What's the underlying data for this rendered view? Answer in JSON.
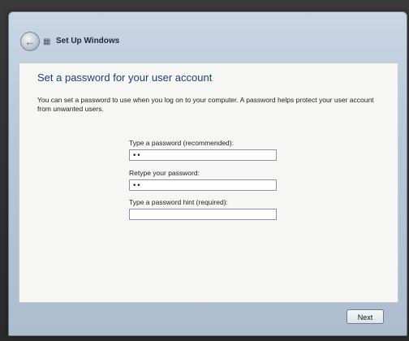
{
  "window": {
    "title": "Set Up Windows"
  },
  "page": {
    "heading": "Set a password for your user account",
    "description": "You can set a password to use when you log on to your computer. A password helps protect your user account from unwanted users."
  },
  "form": {
    "password_label": "Type a password (recommended):",
    "password_value": "••",
    "retype_label": "Retype your password:",
    "retype_value": "••",
    "hint_label": "Type a password hint (required):",
    "hint_value": ""
  },
  "footer": {
    "next_label": "Next"
  },
  "icons": {
    "back": "back-arrow-icon",
    "setup": "setup-windows-icon"
  }
}
